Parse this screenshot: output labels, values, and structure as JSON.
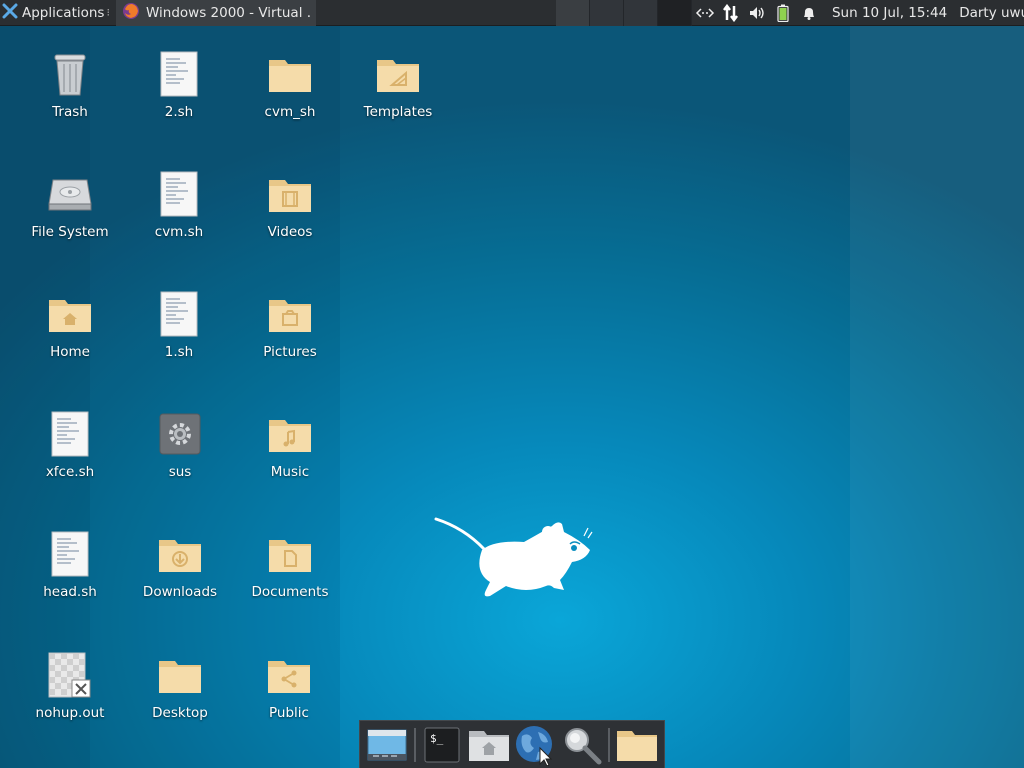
{
  "colors": {
    "panel_bg": "#2b2e31",
    "desktop_accent": "#0a9fd3",
    "folder": "#f2d9a8"
  },
  "top_panel": {
    "applications_label": "Applications",
    "applications_icon": "xfce-logo-icon",
    "tasks": [
      {
        "title": "Windows 2000 - Virtual ...",
        "icon": "firefox-icon"
      }
    ],
    "workspaces_count": 4,
    "tray_icons": [
      "network-icon",
      "network-transfer-icon",
      "volume-icon",
      "battery-icon",
      "notification-bell-icon"
    ],
    "clock": "Sun 10 Jul, 15:44",
    "user": "Darty uwu"
  },
  "desktop": {
    "icons": [
      {
        "name": "Trash",
        "type": "trash"
      },
      {
        "name": "2.sh",
        "type": "script"
      },
      {
        "name": "cvm_sh",
        "type": "folder"
      },
      {
        "name": "Templates",
        "type": "folder-templates"
      },
      {
        "name": "File System",
        "type": "drive"
      },
      {
        "name": "cvm.sh",
        "type": "script"
      },
      {
        "name": "Videos",
        "type": "folder-videos"
      },
      {
        "name": "Home",
        "type": "folder-home"
      },
      {
        "name": "1.sh",
        "type": "script"
      },
      {
        "name": "Pictures",
        "type": "folder-pictures"
      },
      {
        "name": "xfce.sh",
        "type": "script"
      },
      {
        "name": "sus",
        "type": "executable"
      },
      {
        "name": "Music",
        "type": "folder-music"
      },
      {
        "name": "head.sh",
        "type": "script"
      },
      {
        "name": "Downloads",
        "type": "folder-downloads"
      },
      {
        "name": "Documents",
        "type": "folder-documents"
      },
      {
        "name": "nohup.out",
        "type": "broken-file"
      },
      {
        "name": "Desktop",
        "type": "folder"
      },
      {
        "name": "Public",
        "type": "folder-public"
      }
    ]
  },
  "dock": {
    "items": [
      "show-desktop-icon",
      "terminal-icon",
      "home-folder-icon",
      "web-browser-icon",
      "search-icon",
      "folder-icon"
    ]
  }
}
